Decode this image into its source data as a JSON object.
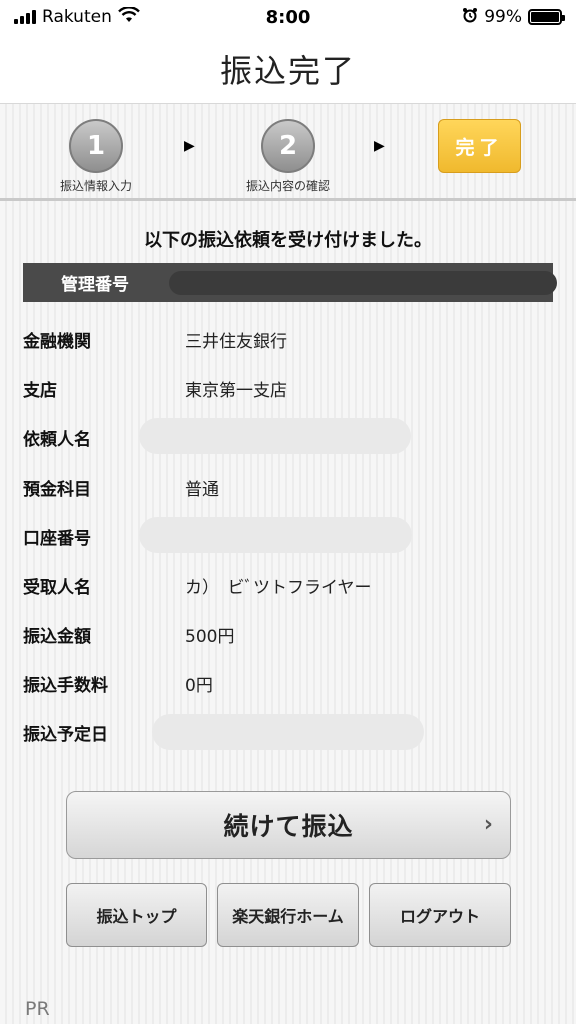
{
  "status_bar": {
    "carrier": "Rakuten",
    "time": "8:00",
    "battery_percent": "99%",
    "battery_level": 0.99,
    "icons": [
      "signal-icon",
      "wifi-icon",
      "alarm-icon",
      "battery-icon"
    ]
  },
  "header": {
    "title": "振込完了"
  },
  "steps": {
    "step1": {
      "number": "1",
      "label": "振込情報入力"
    },
    "step2": {
      "number": "2",
      "label": "振込内容の確認"
    },
    "arrow": "▶",
    "done_label": "完了"
  },
  "message": "以下の振込依頼を受け付けました。",
  "management": {
    "label": "管理番号"
  },
  "details": [
    {
      "label": "金融機関",
      "value": "三井住友銀行"
    },
    {
      "label": "支店",
      "value": "東京第一支店"
    },
    {
      "label": "依頼人名",
      "value": ""
    },
    {
      "label": "預金科目",
      "value": "普通"
    },
    {
      "label": "口座番号",
      "value": ""
    },
    {
      "label": "受取人名",
      "value": "カ）　ビﾞツトフライヤー"
    },
    {
      "label": "振込金額",
      "value": "500円"
    },
    {
      "label": "振込手数料",
      "value": "0円"
    },
    {
      "label": "振込予定日",
      "value": ""
    }
  ],
  "buttons": {
    "continue": "続けて振込",
    "continue_chevron": "›",
    "transfer_top": "振込トップ",
    "rakuten_home": "楽天銀行ホーム",
    "logout": "ログアウト"
  },
  "footer": {
    "pr": "PR"
  },
  "colors": {
    "done_step": "#f3c23a",
    "management_bar": "#4a4a4a",
    "step_circle": "#a9a9a9"
  }
}
